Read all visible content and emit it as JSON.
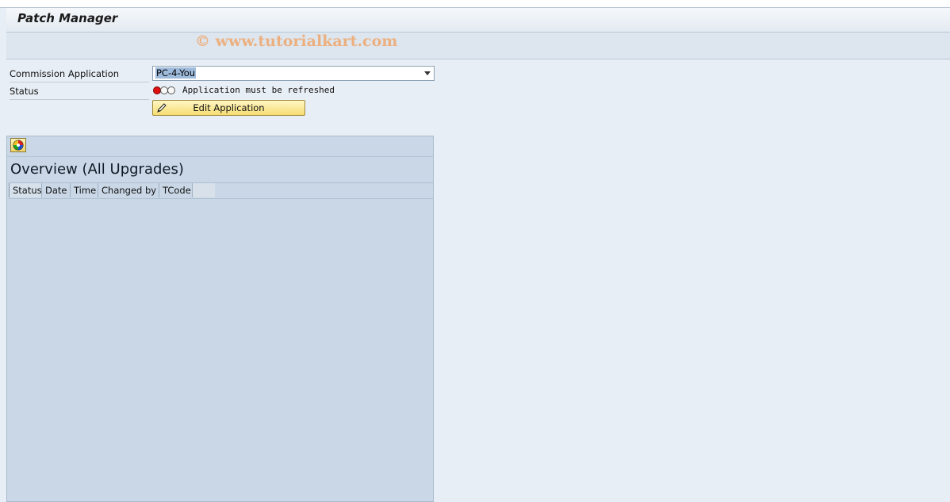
{
  "header": {
    "title": "Patch Manager"
  },
  "watermark": "© www.tutorialkart.com",
  "form": {
    "commission_application": {
      "label": "Commission Application",
      "value": "PC-4-You"
    },
    "status": {
      "label": "Status",
      "text": "Application must be refreshed",
      "light": "red"
    },
    "edit_button_label": "Edit Application"
  },
  "overview": {
    "title": "Overview (All Upgrades)",
    "columns": [
      "Status",
      "Date",
      "Time",
      "Changed by",
      "TCode"
    ],
    "rows": []
  },
  "icons": {
    "pencil": "pencil-icon",
    "refresh": "refresh-icon",
    "dropdown": "chevron-down-icon",
    "traffic_light": "traffic-light-icon"
  },
  "colors": {
    "background": "#e8eef5",
    "panel": "#c9d7e6",
    "button": "#f6dd72",
    "selection": "#9ebbdc",
    "status_red": "#e01010"
  }
}
